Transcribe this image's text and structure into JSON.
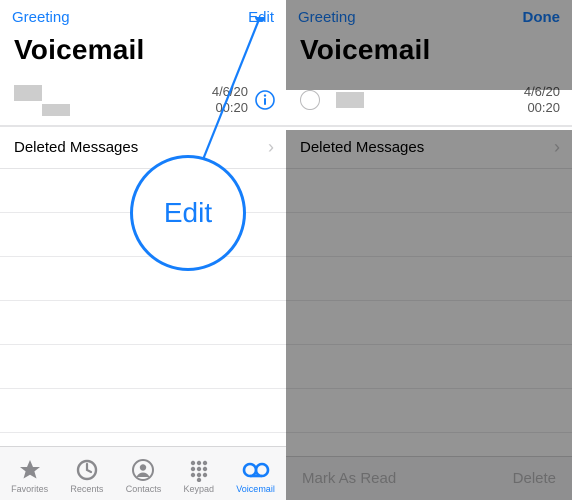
{
  "left": {
    "nav": {
      "greeting": "Greeting",
      "edit": "Edit"
    },
    "title": "Voicemail",
    "item": {
      "date": "4/6/20",
      "duration": "00:20"
    },
    "deleted": "Deleted Messages",
    "callout": "Edit",
    "tabs": {
      "favorites": "Favorites",
      "recents": "Recents",
      "contacts": "Contacts",
      "keypad": "Keypad",
      "voicemail": "Voicemail"
    }
  },
  "right": {
    "nav": {
      "greeting": "Greeting",
      "done": "Done"
    },
    "title": "Voicemail",
    "item": {
      "date": "4/6/20",
      "duration": "00:20"
    },
    "deleted": "Deleted Messages",
    "actions": {
      "mark": "Mark As Read",
      "delete": "Delete"
    }
  }
}
